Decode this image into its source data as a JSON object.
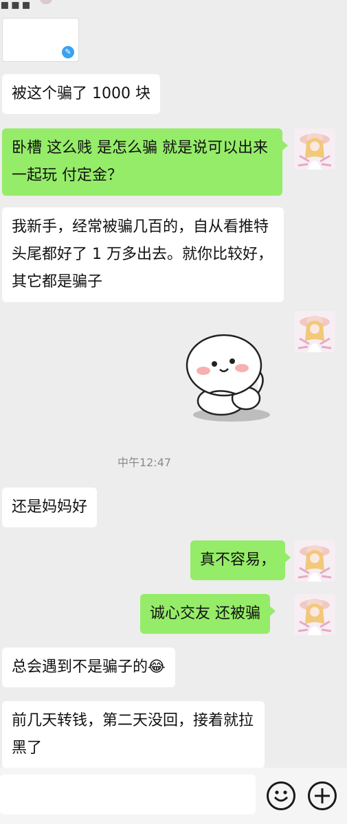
{
  "messages": [
    {
      "id": "m1",
      "side": "left",
      "text": "被这个骗了 1000 块"
    },
    {
      "id": "m2",
      "side": "right",
      "text": "卧槽 这么贱 是怎么骗 就是说可以出来 一起玩 付定金？"
    },
    {
      "id": "m3",
      "side": "left",
      "text": "我新手，经常被骗几百的，自从看推特头尾都好了 1 万多出去。就你比较好，其它都是骗子"
    },
    {
      "id": "m4",
      "side": "left",
      "text": "还是妈妈好"
    },
    {
      "id": "m5",
      "side": "right",
      "text": "真不容易，"
    },
    {
      "id": "m6",
      "side": "right",
      "text": "诚心交友 还被骗"
    },
    {
      "id": "m7",
      "side": "left",
      "text": "总会遇到不是骗子的",
      "emoji": "😂"
    },
    {
      "id": "m8",
      "side": "left",
      "text": "前几天转钱，第二天没回，接着就拉黑了"
    }
  ],
  "timestamp": "中午12:47",
  "sticker": {
    "icon": "bun-sticker-icon"
  },
  "image_card": {
    "icon": "image-badge-icon"
  },
  "input_bar": {
    "emoji_icon": "smiley-icon",
    "add_icon": "plus-icon"
  },
  "colors": {
    "bg": "#ededed",
    "bubble_self": "#95ec69",
    "bubble_other": "#ffffff",
    "timestamp": "#8a8a8a"
  }
}
